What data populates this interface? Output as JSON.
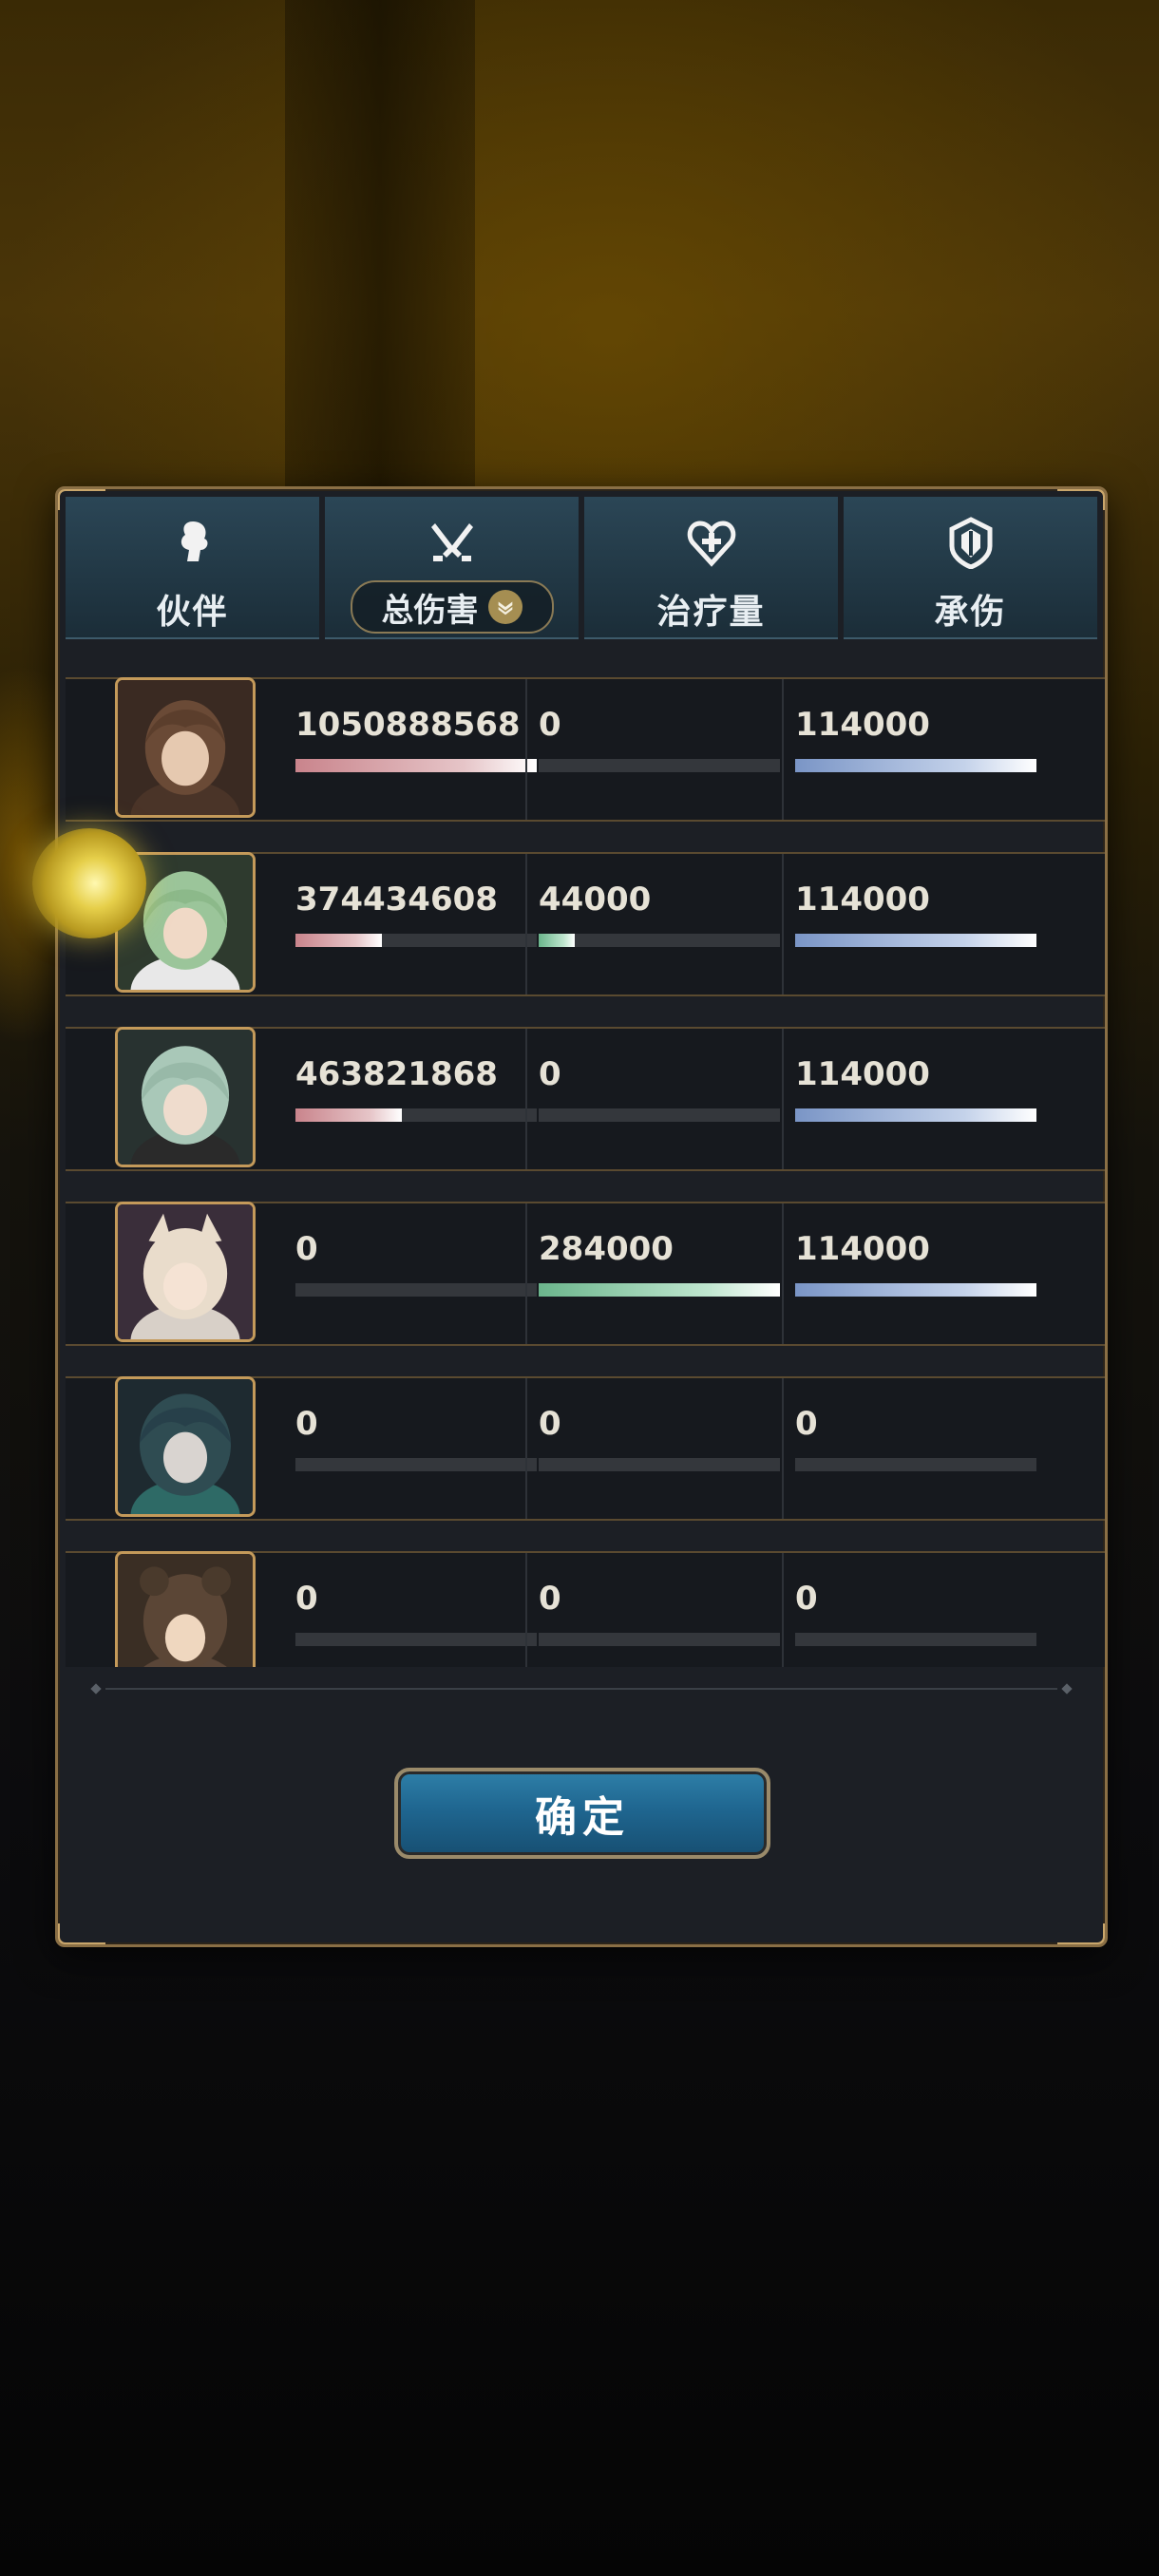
{
  "header": {
    "tabs": [
      {
        "id": "partner",
        "label": "伙伴",
        "icon": "partner-icon"
      },
      {
        "id": "damage",
        "label": "总伤害",
        "icon": "swords-icon",
        "active": true
      },
      {
        "id": "heal",
        "label": "治疗量",
        "icon": "heart-cross-icon"
      },
      {
        "id": "tank",
        "label": "承伤",
        "icon": "shield-icon"
      }
    ]
  },
  "rows": [
    {
      "avatar": "character-1-portrait",
      "damage": "1050888568",
      "heal": "0",
      "taken": "114000",
      "damage_pct": 1.0,
      "heal_pct": 0,
      "taken_pct": 1.0
    },
    {
      "avatar": "character-2-portrait",
      "damage": "374434608",
      "heal": "44000",
      "taken": "114000",
      "damage_pct": 0.36,
      "heal_pct": 0.15,
      "taken_pct": 1.0
    },
    {
      "avatar": "character-3-portrait",
      "damage": "463821868",
      "heal": "0",
      "taken": "114000",
      "damage_pct": 0.44,
      "heal_pct": 0,
      "taken_pct": 1.0
    },
    {
      "avatar": "character-4-portrait",
      "damage": "0",
      "heal": "284000",
      "taken": "114000",
      "damage_pct": 0,
      "heal_pct": 1.0,
      "taken_pct": 1.0
    },
    {
      "avatar": "character-5-portrait",
      "damage": "0",
      "heal": "0",
      "taken": "0",
      "damage_pct": 0,
      "heal_pct": 0,
      "taken_pct": 0
    },
    {
      "avatar": "character-6-portrait",
      "damage": "0",
      "heal": "0",
      "taken": "0",
      "damage_pct": 0,
      "heal_pct": 0,
      "taken_pct": 0
    }
  ],
  "confirm_label": "确定",
  "colors": {
    "damage": "#c9848c",
    "heal": "#6bb58c",
    "tank": "#7a95c6",
    "accent": "#c49a5a"
  }
}
